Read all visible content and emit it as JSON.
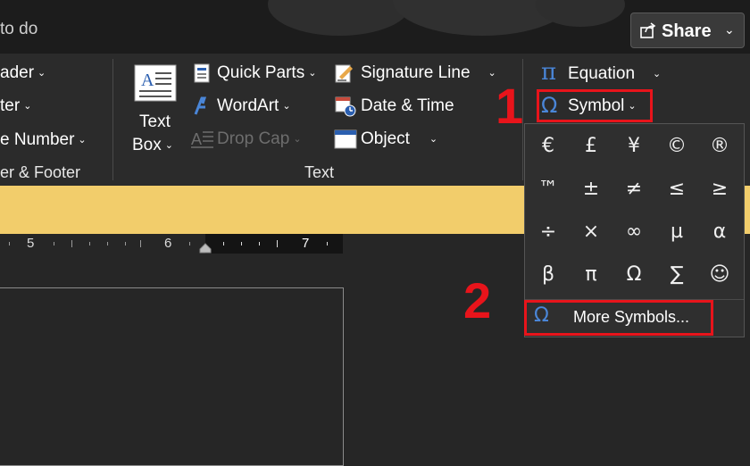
{
  "title_bar": {
    "title": "to do",
    "share_label": "Share",
    "share_chevron": "⌄"
  },
  "ribbon": {
    "header_footer_group": {
      "header": "ader",
      "footer": "ter",
      "page_number": "e Number",
      "label": "er & Footer"
    },
    "text_group": {
      "text_box_line1": "Text",
      "text_box_line2": "Box",
      "quick_parts": "Quick Parts",
      "wordart": "WordArt",
      "drop_cap": "Drop Cap",
      "signature_line": "Signature Line",
      "date_time": "Date & Time",
      "object": "Object",
      "label": "Text"
    },
    "symbols_group": {
      "equation": "Equation",
      "symbol": "Symbol"
    }
  },
  "symbol_menu": {
    "symbols": [
      "€",
      "£",
      "¥",
      "©",
      "®",
      "™",
      "±",
      "≠",
      "≤",
      "≥",
      "÷",
      "×",
      "∞",
      "µ",
      "α",
      "β",
      "π",
      "Ω",
      "∑",
      "☺"
    ],
    "more_symbols": "More Symbols..."
  },
  "ruler": {
    "numbers": [
      "5",
      "6",
      "7"
    ]
  },
  "annotations": {
    "step1": "1",
    "step2": "2"
  },
  "colors": {
    "annotation_red": "#e8141b",
    "accent_blue": "#4a86d8",
    "yellow_band": "#f2cd6b"
  }
}
